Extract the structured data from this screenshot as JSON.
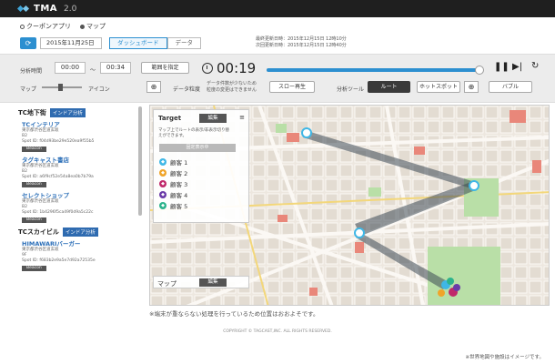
{
  "app": {
    "logo": "TMA",
    "version": "2.0"
  },
  "nav": {
    "items": [
      "クーポンアプリ",
      "マップ"
    ]
  },
  "date": {
    "value": "2015年11月25日"
  },
  "tabs": [
    "ダッシュボード",
    "データ"
  ],
  "updates": {
    "last": "最終更新日時：2015年12月15日 12時10分",
    "next": "次回更新日時：2015年12月15日 12時40分"
  },
  "controls": {
    "period_label": "分析時間",
    "start": "00:00",
    "separator": "〜",
    "end": "00:34",
    "range_button": "範囲を指定",
    "time": "00:19",
    "progress": 0.99,
    "map_label": "マップ",
    "icon_label": "アイコン",
    "accuracy_label": "データ粒度",
    "accuracy_note": "データ件数が少ないため\n粒度の変更はできません",
    "slow_button": "スロー再生",
    "tool_label": "分析ツール",
    "route_button": "ルート",
    "hotspot_button": "ホットスポット",
    "bubble_button": "バブル",
    "map_slider": 0.45
  },
  "sidebar": {
    "sections": [
      {
        "title": "TC地下街",
        "badge": "インドア分析",
        "shops": [
          {
            "name": "TCインテリア",
            "address": "東京都渋谷区道玄坂",
            "floor": "B2",
            "spot": "Spot ID: f04d93be29e520ea9f55b5",
            "button": "Beacon"
          },
          {
            "name": "タグキャスト書店",
            "address": "東京都渋谷区道玄坂",
            "floor": "B2",
            "spot": "Spot ID: a6f9cf52e54a8ea0b7b79a",
            "button": "Beacon"
          },
          {
            "name": "セレクトショップ",
            "address": "東京都渋谷区道玄坂",
            "floor": "B2",
            "spot": "Spot ID: 1b4296f5ca49f0d9a5c22c",
            "button": "Beacon"
          }
        ]
      },
      {
        "title": "TCスカイビル",
        "badge": "インドア分析",
        "shops": [
          {
            "name": "HIMAWARIバーガー",
            "address": "東京都渋谷区道玄坂",
            "floor": "9F",
            "spot": "Spot ID: f683b2e9a5e7d92a72535e",
            "button": "Beacon"
          }
        ]
      }
    ]
  },
  "panel": {
    "title": "Target",
    "edit": "編集",
    "menu": "≡",
    "desc": "マップ上でルートの表示/非表示切り替えができます。",
    "filter": "固定表示中",
    "customers": [
      {
        "label": "顧客 1",
        "color": "#3fb7e6"
      },
      {
        "label": "顧客 2",
        "color": "#f0a429"
      },
      {
        "label": "顧客 3",
        "color": "#c0286a"
      },
      {
        "label": "顧客 4",
        "color": "#6a3aa8"
      },
      {
        "label": "顧客 5",
        "color": "#2cb38c"
      }
    ]
  },
  "map_box": {
    "label": "マップ",
    "edit": "編集"
  },
  "footnote": "※端末が重ならない処理を行っているため位置はおおよそです。",
  "copyright": "COPYRIGHT © TAGCAST,INC. ALL RIGHTS RESERVED.",
  "caption": "※世界地図や施設はイメージです。",
  "colors": {
    "accent": "#2c8fd0",
    "header": "#1f1f1f"
  }
}
